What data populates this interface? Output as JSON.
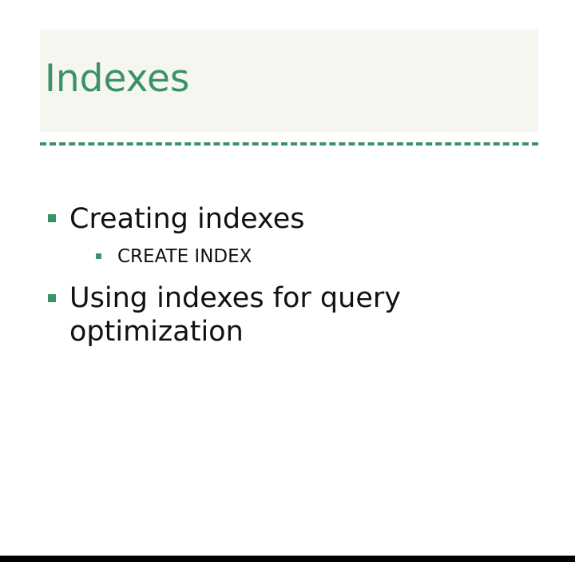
{
  "slide": {
    "title": "Indexes",
    "bullets": [
      {
        "text": "Creating indexes",
        "children": [
          {
            "text": "CREATE INDEX"
          }
        ]
      },
      {
        "line1": "Using indexes for query",
        "line2": "optimization"
      }
    ]
  },
  "colors": {
    "accent": "#3a9266",
    "title_band": "#f6f6f0",
    "text": "#111111",
    "bottom_bar": "#000000"
  }
}
